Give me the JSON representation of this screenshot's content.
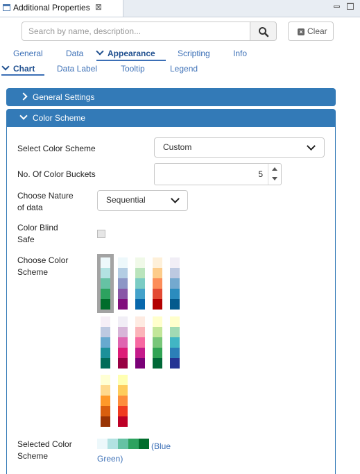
{
  "view": {
    "title": "Additional Properties",
    "close": "⊠"
  },
  "search": {
    "placeholder": "Search by name, description...",
    "clear_label": "Clear"
  },
  "tabs": [
    "General",
    "Data",
    "Appearance",
    "Scripting",
    "Info"
  ],
  "subtabs": [
    "Chart",
    "Data Label",
    "Tooltip",
    "Legend"
  ],
  "sections": {
    "general_settings": "General Settings",
    "color_scheme": "Color Scheme"
  },
  "form": {
    "select_color_scheme_label": "Select Color Scheme",
    "select_color_scheme_value": "Custom",
    "buckets_label": "No. Of Color Buckets",
    "buckets_value": "5",
    "nature_label_1": "Choose Nature",
    "nature_label_2": "of data",
    "nature_value": "Sequential",
    "color_blind_label_1": "Color Blind",
    "color_blind_label_2": "Safe",
    "color_blind_checked": false,
    "choose_scheme_label_1": "Choose Color",
    "choose_scheme_label_2": "Scheme",
    "selected_label_1": "Selected Color",
    "selected_label_2": "Scheme",
    "selected_name_1": "(Blue",
    "selected_name_2": "Green)"
  },
  "palettes": [
    [
      "#edf8fb",
      "#b2e2e2",
      "#66c2a4",
      "#2ca25f",
      "#006d2c"
    ],
    [
      "#edf8fb",
      "#b3cde3",
      "#8c96c6",
      "#8856a7",
      "#810f7c"
    ],
    [
      "#f0f9e8",
      "#bae4bc",
      "#7bccc4",
      "#43a2ca",
      "#0868ac"
    ],
    [
      "#fef0d9",
      "#fdcc8a",
      "#fc8d59",
      "#e34a33",
      "#b30000"
    ],
    [
      "#f1eef6",
      "#bdc9e1",
      "#74a9cf",
      "#2b8cbe",
      "#045a8d"
    ],
    [
      "#f6eff7",
      "#bdc9e1",
      "#67a9cf",
      "#1c9099",
      "#016c59"
    ],
    [
      "#f1eef6",
      "#d7b5d8",
      "#df65b0",
      "#dd1c77",
      "#980043"
    ],
    [
      "#feebe2",
      "#fbb4b9",
      "#f768a1",
      "#c51b8a",
      "#7a0177"
    ],
    [
      "#ffffcc",
      "#c2e699",
      "#78c679",
      "#31a354",
      "#006837"
    ],
    [
      "#ffffcc",
      "#a1dab4",
      "#41b6c4",
      "#2c7fb8",
      "#253494"
    ],
    [
      "#ffffd4",
      "#fed98e",
      "#fe9929",
      "#d95f0e",
      "#993404"
    ],
    [
      "#ffffb2",
      "#fecc5c",
      "#fd8d3c",
      "#f03b20",
      "#bd0026"
    ]
  ],
  "selected_palette_index": 0,
  "selected_palette": [
    "#edf8fb",
    "#b2e2e2",
    "#66c2a4",
    "#2ca25f",
    "#006d2c"
  ]
}
